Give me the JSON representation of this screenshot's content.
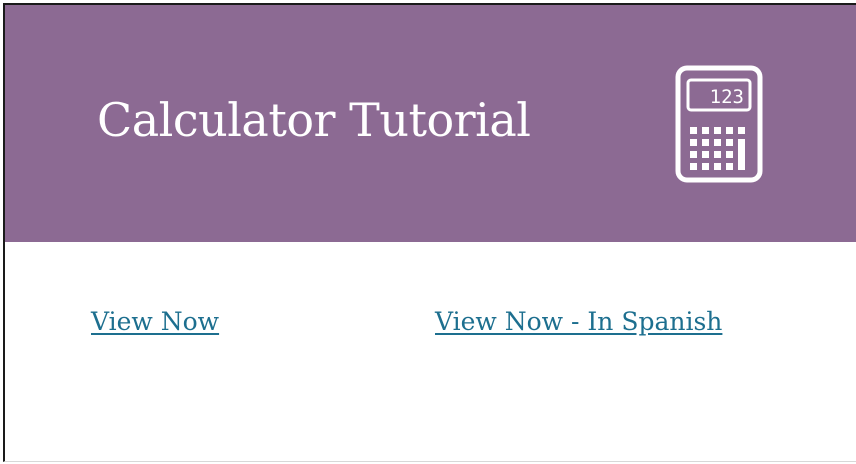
{
  "banner": {
    "title": "Calculator Tutorial",
    "icon": "calculator-icon",
    "icon_display_digits": "123",
    "background_color": "#8c6a93",
    "text_color": "#ffffff"
  },
  "links": [
    {
      "label": "View Now"
    },
    {
      "label": "View Now - In Spanish"
    }
  ],
  "link_color": "#1d6f8f"
}
